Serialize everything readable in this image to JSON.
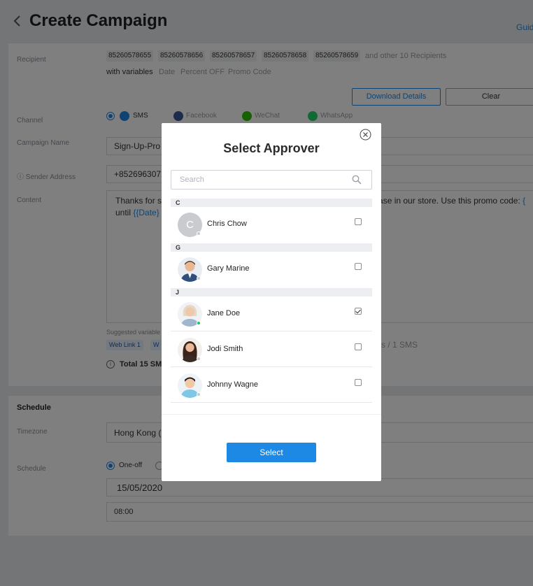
{
  "header": {
    "title": "Create Campaign",
    "guide_link": "Guide"
  },
  "form": {
    "recipient_label": "Recipient",
    "recipients": [
      "85260578655",
      "85260578656",
      "85260578657",
      "85260578658",
      "85260578659"
    ],
    "recipients_more": "and other 10 Recipients",
    "with_variables_label": "with variables",
    "variables": [
      "Date",
      "Percent OFF",
      "Promo Code"
    ],
    "download_button": "Download Details",
    "clear_button": "Clear",
    "channel_label": "Channel",
    "channels": [
      "SMS",
      "Facebook",
      "WeChat",
      "WhatsApp"
    ],
    "campaign_name_label": "Campaign Name",
    "campaign_name_value": "Sign-Up-Pro",
    "sender_label": "Sender Address",
    "sender_value": "+85269630727",
    "content_label": "Content",
    "content_part1": "Thanks for s",
    "content_part2": "ase in our store. Use this promo code: ",
    "content_var1": "{",
    "content_line2_prefix": "until ",
    "content_var2": "{{Date}",
    "suggested_label": "Suggested variable",
    "suggested_tags": [
      "Web Link 1",
      "W"
    ],
    "sms_count": "s / 1 SMS",
    "total_label": "Total 15 SM"
  },
  "schedule": {
    "section_title": "Schedule",
    "timezone_label": "Timezone",
    "timezone_value": "Hong Kong (U",
    "schedule_label": "Schedule",
    "one_off": "One-off",
    "date_value": "15/05/2020",
    "time_value": "08:00"
  },
  "modal": {
    "title": "Select Approver",
    "search_placeholder": "Search",
    "groups": [
      {
        "letter": "C"
      },
      {
        "letter": "G"
      },
      {
        "letter": "J"
      }
    ],
    "approvers": [
      {
        "name": "Chris Chow",
        "initial": "C",
        "checked": false,
        "online": false
      },
      {
        "name": "Gary Marine",
        "checked": false,
        "online": false
      },
      {
        "name": "Jane Doe",
        "checked": true,
        "online": true
      },
      {
        "name": "Jodi Smith",
        "checked": false,
        "online": false
      },
      {
        "name": "Johnny Wagne",
        "checked": false,
        "online": false
      }
    ],
    "select_button": "Select"
  },
  "colors": {
    "accent": "#1e88e5",
    "online": "#22c55e",
    "overlay": "rgba(0,0,0,0.5)"
  }
}
